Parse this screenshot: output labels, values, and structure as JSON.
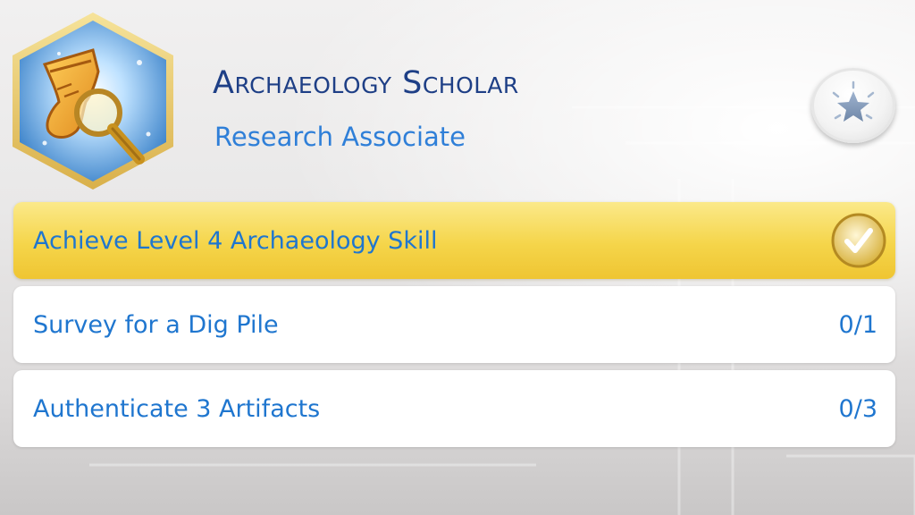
{
  "aspiration": {
    "title": "Archaeology Scholar",
    "subtitle": "Research Associate",
    "icon": "artifact-magnifier-icon"
  },
  "reward_button": {
    "icon": "star-icon"
  },
  "goals": [
    {
      "label": "Achieve Level 4 Archaeology Skill",
      "completed": true,
      "icon": "checkmark-icon"
    },
    {
      "label": "Survey for a Dig Pile",
      "completed": false,
      "progress": "0/1"
    },
    {
      "label": "Authenticate 3 Artifacts",
      "completed": false,
      "progress": "0/3"
    }
  ],
  "colors": {
    "title": "#1e3f86",
    "subtitle": "#2f7fd8",
    "goal_text": "#1f76cf",
    "completed_goal": "#f5d54a"
  }
}
